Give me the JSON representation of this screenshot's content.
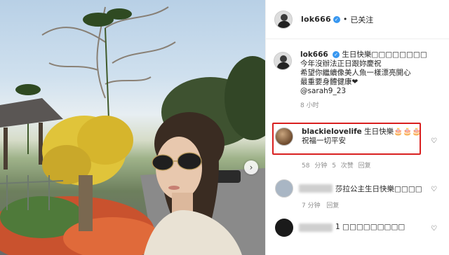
{
  "post": {
    "author": "lok666",
    "follow_label": "已关注",
    "dot": "•"
  },
  "caption": {
    "username": "lok666",
    "lines": [
      "生日快樂□□□□□□□□",
      "今年沒辦法正日跟妳慶祝",
      "希望你繼續像美人魚一樣漂亮開心",
      "最重要身體健康❤",
      "@sarah9_23"
    ],
    "time": "8 小时"
  },
  "comments": [
    {
      "username": "blackielovelife",
      "text": "生日快樂🎂🎂🎂",
      "line2": "祝福一切平安",
      "time": "58 分钟",
      "likes": "5 次赞",
      "reply": "回复"
    },
    {
      "username": "",
      "text": "莎拉公主生日快樂□□□□",
      "time": "7 分钟",
      "reply": "回复"
    },
    {
      "username": "",
      "text": "1 □□□□□□□□□"
    }
  ],
  "icons": {
    "next": "chevron-right-icon",
    "verified": "verified-badge-icon",
    "like": "heart-icon"
  },
  "colors": {
    "highlight": "#d92020",
    "verified": "#3897f0"
  }
}
